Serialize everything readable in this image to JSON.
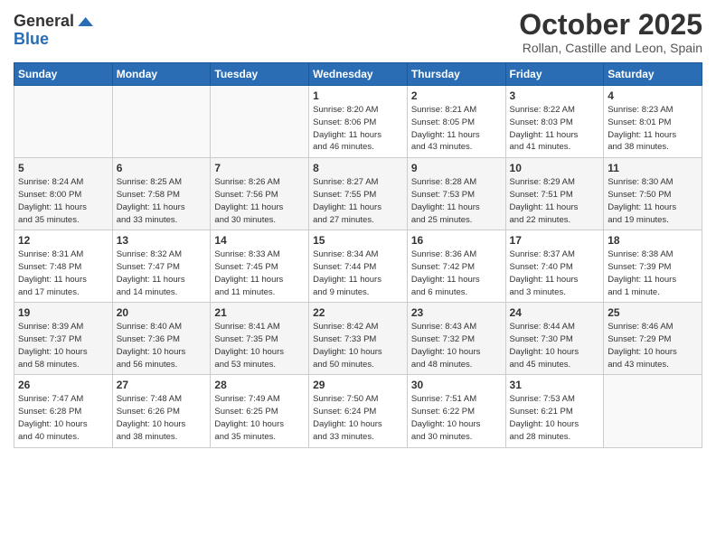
{
  "header": {
    "logo_line1": "General",
    "logo_line2": "Blue",
    "month": "October 2025",
    "location": "Rollan, Castille and Leon, Spain"
  },
  "days_of_week": [
    "Sunday",
    "Monday",
    "Tuesday",
    "Wednesday",
    "Thursday",
    "Friday",
    "Saturday"
  ],
  "weeks": [
    [
      {
        "day": "",
        "info": ""
      },
      {
        "day": "",
        "info": ""
      },
      {
        "day": "",
        "info": ""
      },
      {
        "day": "1",
        "info": "Sunrise: 8:20 AM\nSunset: 8:06 PM\nDaylight: 11 hours\nand 46 minutes."
      },
      {
        "day": "2",
        "info": "Sunrise: 8:21 AM\nSunset: 8:05 PM\nDaylight: 11 hours\nand 43 minutes."
      },
      {
        "day": "3",
        "info": "Sunrise: 8:22 AM\nSunset: 8:03 PM\nDaylight: 11 hours\nand 41 minutes."
      },
      {
        "day": "4",
        "info": "Sunrise: 8:23 AM\nSunset: 8:01 PM\nDaylight: 11 hours\nand 38 minutes."
      }
    ],
    [
      {
        "day": "5",
        "info": "Sunrise: 8:24 AM\nSunset: 8:00 PM\nDaylight: 11 hours\nand 35 minutes."
      },
      {
        "day": "6",
        "info": "Sunrise: 8:25 AM\nSunset: 7:58 PM\nDaylight: 11 hours\nand 33 minutes."
      },
      {
        "day": "7",
        "info": "Sunrise: 8:26 AM\nSunset: 7:56 PM\nDaylight: 11 hours\nand 30 minutes."
      },
      {
        "day": "8",
        "info": "Sunrise: 8:27 AM\nSunset: 7:55 PM\nDaylight: 11 hours\nand 27 minutes."
      },
      {
        "day": "9",
        "info": "Sunrise: 8:28 AM\nSunset: 7:53 PM\nDaylight: 11 hours\nand 25 minutes."
      },
      {
        "day": "10",
        "info": "Sunrise: 8:29 AM\nSunset: 7:51 PM\nDaylight: 11 hours\nand 22 minutes."
      },
      {
        "day": "11",
        "info": "Sunrise: 8:30 AM\nSunset: 7:50 PM\nDaylight: 11 hours\nand 19 minutes."
      }
    ],
    [
      {
        "day": "12",
        "info": "Sunrise: 8:31 AM\nSunset: 7:48 PM\nDaylight: 11 hours\nand 17 minutes."
      },
      {
        "day": "13",
        "info": "Sunrise: 8:32 AM\nSunset: 7:47 PM\nDaylight: 11 hours\nand 14 minutes."
      },
      {
        "day": "14",
        "info": "Sunrise: 8:33 AM\nSunset: 7:45 PM\nDaylight: 11 hours\nand 11 minutes."
      },
      {
        "day": "15",
        "info": "Sunrise: 8:34 AM\nSunset: 7:44 PM\nDaylight: 11 hours\nand 9 minutes."
      },
      {
        "day": "16",
        "info": "Sunrise: 8:36 AM\nSunset: 7:42 PM\nDaylight: 11 hours\nand 6 minutes."
      },
      {
        "day": "17",
        "info": "Sunrise: 8:37 AM\nSunset: 7:40 PM\nDaylight: 11 hours\nand 3 minutes."
      },
      {
        "day": "18",
        "info": "Sunrise: 8:38 AM\nSunset: 7:39 PM\nDaylight: 11 hours\nand 1 minute."
      }
    ],
    [
      {
        "day": "19",
        "info": "Sunrise: 8:39 AM\nSunset: 7:37 PM\nDaylight: 10 hours\nand 58 minutes."
      },
      {
        "day": "20",
        "info": "Sunrise: 8:40 AM\nSunset: 7:36 PM\nDaylight: 10 hours\nand 56 minutes."
      },
      {
        "day": "21",
        "info": "Sunrise: 8:41 AM\nSunset: 7:35 PM\nDaylight: 10 hours\nand 53 minutes."
      },
      {
        "day": "22",
        "info": "Sunrise: 8:42 AM\nSunset: 7:33 PM\nDaylight: 10 hours\nand 50 minutes."
      },
      {
        "day": "23",
        "info": "Sunrise: 8:43 AM\nSunset: 7:32 PM\nDaylight: 10 hours\nand 48 minutes."
      },
      {
        "day": "24",
        "info": "Sunrise: 8:44 AM\nSunset: 7:30 PM\nDaylight: 10 hours\nand 45 minutes."
      },
      {
        "day": "25",
        "info": "Sunrise: 8:46 AM\nSunset: 7:29 PM\nDaylight: 10 hours\nand 43 minutes."
      }
    ],
    [
      {
        "day": "26",
        "info": "Sunrise: 7:47 AM\nSunset: 6:28 PM\nDaylight: 10 hours\nand 40 minutes."
      },
      {
        "day": "27",
        "info": "Sunrise: 7:48 AM\nSunset: 6:26 PM\nDaylight: 10 hours\nand 38 minutes."
      },
      {
        "day": "28",
        "info": "Sunrise: 7:49 AM\nSunset: 6:25 PM\nDaylight: 10 hours\nand 35 minutes."
      },
      {
        "day": "29",
        "info": "Sunrise: 7:50 AM\nSunset: 6:24 PM\nDaylight: 10 hours\nand 33 minutes."
      },
      {
        "day": "30",
        "info": "Sunrise: 7:51 AM\nSunset: 6:22 PM\nDaylight: 10 hours\nand 30 minutes."
      },
      {
        "day": "31",
        "info": "Sunrise: 7:53 AM\nSunset: 6:21 PM\nDaylight: 10 hours\nand 28 minutes."
      },
      {
        "day": "",
        "info": ""
      }
    ]
  ]
}
